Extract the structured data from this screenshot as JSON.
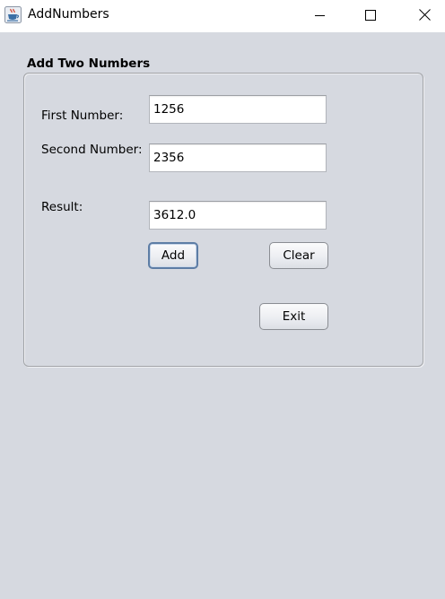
{
  "window": {
    "title": "AddNumbers",
    "icon": "java-cup-icon"
  },
  "panel": {
    "title": "Add Two Numbers"
  },
  "form": {
    "first_label": "First Number:",
    "first_value": "1256",
    "second_label": "Second Number:",
    "second_value": "2356",
    "result_label": "Result:",
    "result_value": "3612.0"
  },
  "buttons": {
    "add": "Add",
    "clear": "Clear",
    "exit": "Exit"
  },
  "colors": {
    "background": "#d6d9e0",
    "titlebar": "#ffffff",
    "focus_border": "#5d7da5"
  }
}
